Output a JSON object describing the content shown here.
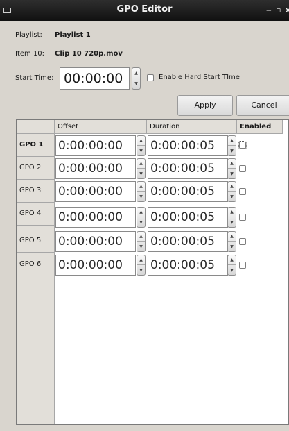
{
  "window": {
    "title": "GPO Editor",
    "minimize_glyph": "‒",
    "maximize_glyph": "▫",
    "close_glyph": "×"
  },
  "info": {
    "playlist_label": "Playlist:",
    "playlist_value": "Playlist 1",
    "item_label": "Item 10:",
    "item_value": "Clip 10 720p.mov",
    "start_time_label": "Start Time:",
    "start_time_value": "00:00:00",
    "hard_start_label": "Enable Hard Start TIme",
    "hard_start_checked": false
  },
  "buttons": {
    "apply": "Apply",
    "cancel": "Cancel"
  },
  "table": {
    "columns": [
      "Offset",
      "Duration",
      "Enabled"
    ],
    "rows": [
      {
        "label": "GPO 1",
        "offset": "0:00:00:00",
        "duration": "0:00:00:05",
        "enabled": false,
        "selected": true
      },
      {
        "label": "GPO 2",
        "offset": "0:00:00:00",
        "duration": "0:00:00:05",
        "enabled": false,
        "selected": false
      },
      {
        "label": "GPO 3",
        "offset": "0:00:00:00",
        "duration": "0:00:00:05",
        "enabled": false,
        "selected": false
      },
      {
        "label": "GPO 4",
        "offset": "0:00:00:00",
        "duration": "0:00:00:05",
        "enabled": false,
        "selected": false
      },
      {
        "label": "GPO 5",
        "offset": "0:00:00:00",
        "duration": "0:00:00:05",
        "enabled": false,
        "selected": false
      },
      {
        "label": "GPO 6",
        "offset": "0:00:00:00",
        "duration": "0:00:00:05",
        "enabled": false,
        "selected": false
      }
    ]
  }
}
